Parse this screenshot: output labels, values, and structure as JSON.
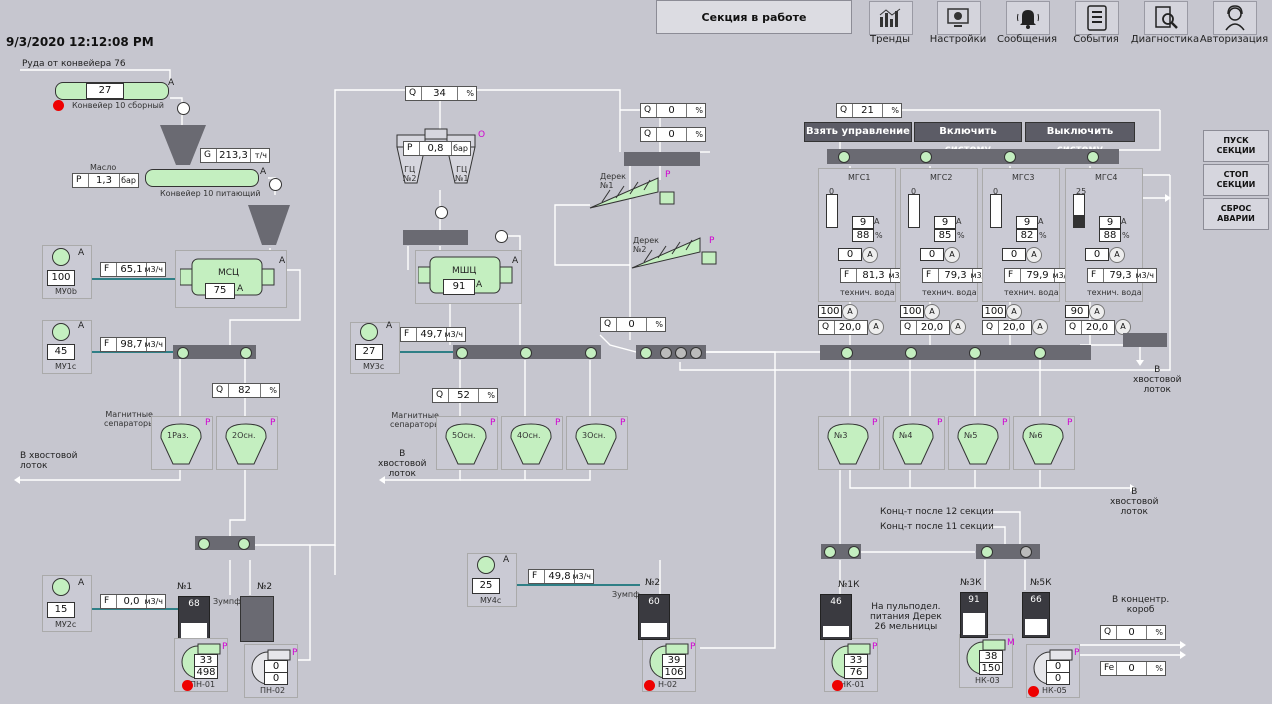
{
  "header": {
    "status_text": "Секция в работе",
    "clock": "9/3/2020 12:12:08 PM",
    "buttons": [
      {
        "id": "trends",
        "label": "Тренды",
        "icon": "chart-icon"
      },
      {
        "id": "settings",
        "label": "Настройки",
        "icon": "settings-monitor-icon"
      },
      {
        "id": "messages",
        "label": "Сообщения",
        "icon": "bell-icon"
      },
      {
        "id": "events",
        "label": "События",
        "icon": "list-icon"
      },
      {
        "id": "diag",
        "label": "Диагностика",
        "icon": "diagnostics-icon"
      },
      {
        "id": "auth",
        "label": "Авторизация",
        "icon": "user-headset-icon"
      }
    ]
  },
  "right_buttons": [
    "ПУСК\nСЕКЦИИ",
    "СТОП\nСЕКЦИИ",
    "СБРОС\nАВАРИИ"
  ],
  "control_buttons": {
    "take": "Взять управление",
    "enable": "Включить систему",
    "disable": "Выключить систему"
  },
  "labels": {
    "ore_from": "Руда от конвейера 76",
    "conv10_collect": "Конвейер 10 сборный",
    "conv10_feed": "Конвейер 10 питающий",
    "oil": "Масло",
    "mag_sep_left": "Магнитные\nсепараторы",
    "mag_sep_mid": "Магнитные\nсепараторы",
    "to_tail_left": "В хвостовой\nлоток",
    "to_tail_mid": "В\nхвостовой\nлоток",
    "to_tail_right1": "В\nхвостовой\nлоток",
    "to_tail_right2": "В\nхвостовой\nлоток",
    "conc_12": "Конц-т после 12 секции",
    "conc_11": "Конц-т после 11 секции",
    "pulp_feed": "На пульподел.\nпитания Дерек\n26 мельницы",
    "to_conc_box": "В концентр.\nкороб",
    "sump1": "Зумпф",
    "sump2": "Зумпф",
    "mcc": "МСЦ",
    "mshc": "МШЦ",
    "gc2": "ГЦ\n№2",
    "gc1": "ГЦ\n№1",
    "derek1": "Дерек\n№1",
    "derek2": "Дерек\n№2",
    "tech_water": "технич. вода"
  },
  "values": {
    "conv10_collect": "27",
    "feed_g": "213,3",
    "feed_g_unit": "т/ч",
    "oil_p": "1,3",
    "oil_p_unit": "бар",
    "mcc_current": "75",
    "mshc_current": "91",
    "f_my0b": "65,1",
    "f_my1c": "98,7",
    "f_my3c": "49,7",
    "f_my4c": "49,8",
    "f_my2c": "0,0",
    "flow_unit": "м3/ч",
    "q_sep_left": "82",
    "q_sep_mid": "52",
    "q_top": "34",
    "q_derek1": "0",
    "q_derek2": "0",
    "q_mid": "0",
    "q_mgs": "21",
    "p_gc": "0,8",
    "p_gc_unit": "бар",
    "pct": "%",
    "q_conc": "0",
    "fe_conc": "0"
  },
  "valves": [
    {
      "id": "МУ0b",
      "v": "100"
    },
    {
      "id": "МУ1c",
      "v": "45"
    },
    {
      "id": "МУ3c",
      "v": "27"
    },
    {
      "id": "МУ4c",
      "v": "25"
    },
    {
      "id": "МУ2c",
      "v": "15"
    }
  ],
  "separators_left": [
    "1Раз.",
    "2Осн."
  ],
  "separators_mid": [
    "5Осн.",
    "4Осн.",
    "3Осн."
  ],
  "separators_right": [
    "№3",
    "№4",
    "№5",
    "№6"
  ],
  "mgs": [
    {
      "name": "МГС1",
      "level": "0",
      "cur": "9",
      "pct": "88",
      "flow": "81,3",
      "valve": "100",
      "q": "20,0"
    },
    {
      "name": "МГС2",
      "level": "0",
      "cur": "9",
      "pct": "85",
      "flow": "79,3",
      "valve": "100",
      "q": "20,0"
    },
    {
      "name": "МГС3",
      "level": "0",
      "cur": "9",
      "pct": "82",
      "flow": "79,9",
      "valve": "100",
      "q": "20,0"
    },
    {
      "name": "МГС4",
      "level": "25",
      "cur": "9",
      "pct": "88",
      "flow": "79,3",
      "valve": "90",
      "q": "20,0"
    }
  ],
  "tanks": [
    {
      "name": "№1",
      "level": "68",
      "level_frac": 0.68
    },
    {
      "name": "№2",
      "level": "",
      "level_frac": 0
    },
    {
      "name": "№2",
      "level": "60",
      "level_frac": 0.6
    },
    {
      "name": "№1К",
      "level": "46",
      "level_frac": 0.46
    },
    {
      "name": "№3К",
      "level": "91",
      "level_frac": 0.91
    },
    {
      "name": "№5К",
      "level": "66",
      "level_frac": 0.66
    }
  ],
  "pumps": [
    {
      "name": "ПН-01",
      "a": "33",
      "b": "498"
    },
    {
      "name": "ПН-02",
      "a": "0",
      "b": "0"
    },
    {
      "name": "Н-02",
      "a": "39",
      "b": "106"
    },
    {
      "name": "НК-01",
      "a": "33",
      "b": "76"
    },
    {
      "name": "НК-03",
      "a": "38",
      "b": "150"
    },
    {
      "name": "НК-05",
      "a": "0",
      "b": "0"
    }
  ]
}
